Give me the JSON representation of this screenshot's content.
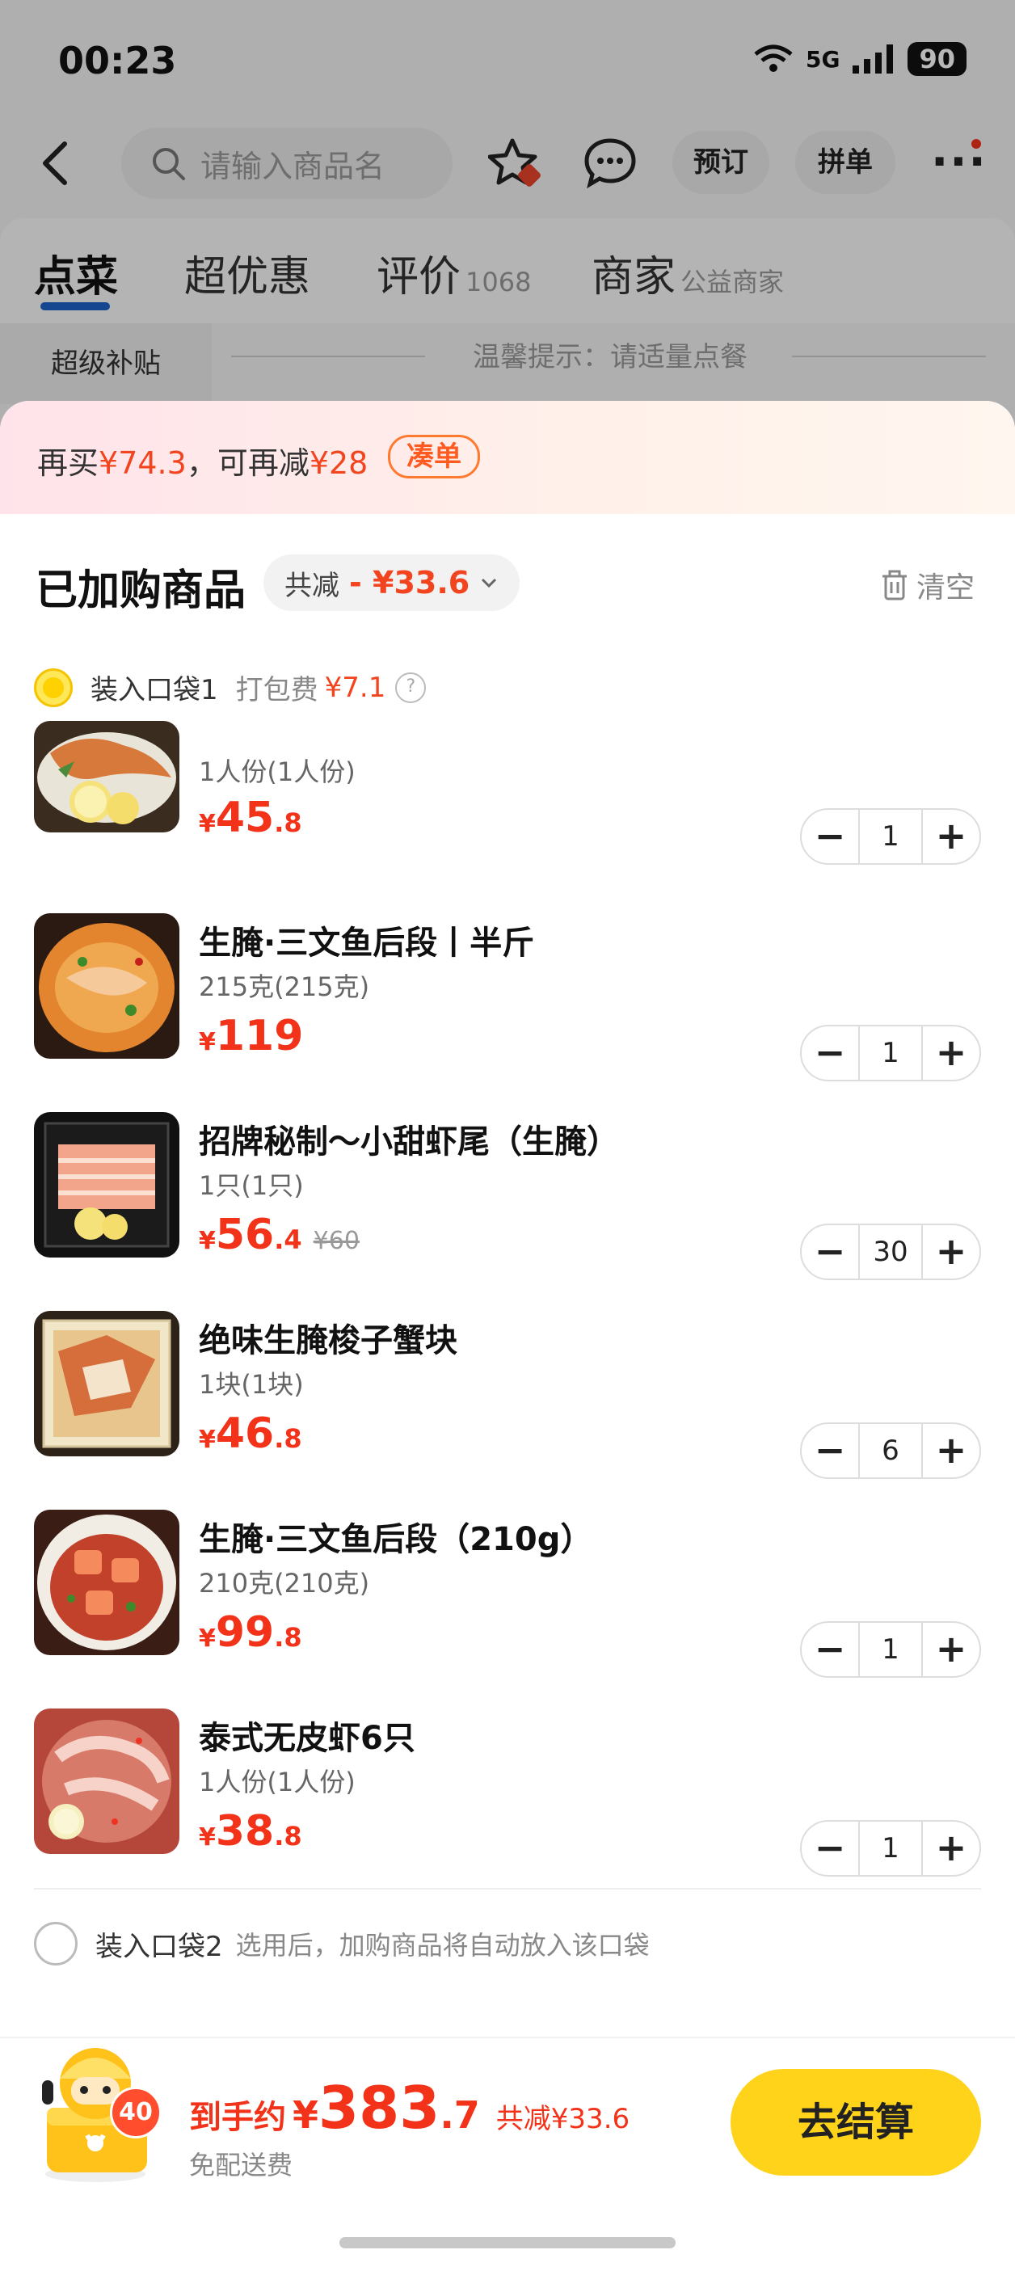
{
  "status_bar": {
    "time": "00:23",
    "network": "5G",
    "battery": "90"
  },
  "header": {
    "search_placeholder": "请输入商品名",
    "preorder_label": "预订",
    "group_order_label": "拼单"
  },
  "tabs": [
    {
      "label": "点菜",
      "sub": ""
    },
    {
      "label": "超优惠",
      "sub": ""
    },
    {
      "label": "评价",
      "sub": "1068"
    },
    {
      "label": "商家",
      "sub": "公益商家"
    }
  ],
  "sidebar_first": "超级补贴",
  "notice": "温馨提示：请适量点餐",
  "promo": {
    "prefix": "再买",
    "amount1": "¥74.3",
    "middle": "，可再减",
    "amount2": "¥28",
    "button": "凑单"
  },
  "cart": {
    "title": "已加购商品",
    "discount_label": "共减",
    "discount_amount": "- ¥33.6",
    "clear_label": "清空"
  },
  "bag1": {
    "label": "装入口袋1",
    "packing_label": "打包费",
    "packing_fee": "¥7.1"
  },
  "items": [
    {
      "name": "",
      "spec": "1人份(1人份)",
      "price_int": "45",
      "price_dec": ".8",
      "old_price": "",
      "qty": "1"
    },
    {
      "name": "生腌·三文鱼后段丨半斤",
      "spec": "215克(215克)",
      "price_int": "119",
      "price_dec": "",
      "old_price": "",
      "qty": "1"
    },
    {
      "name": "招牌秘制～小甜虾尾（生腌）",
      "spec": "1只(1只)",
      "price_int": "56",
      "price_dec": ".4",
      "old_price": "¥60",
      "qty": "30"
    },
    {
      "name": "绝味生腌梭子蟹块",
      "spec": "1块(1块)",
      "price_int": "46",
      "price_dec": ".8",
      "old_price": "",
      "qty": "6"
    },
    {
      "name": "生腌·三文鱼后段（210g）",
      "spec": "210克(210克)",
      "price_int": "99",
      "price_dec": ".8",
      "old_price": "",
      "qty": "1"
    },
    {
      "name": "泰式无皮虾6只",
      "spec": "1人份(1人份)",
      "price_int": "38",
      "price_dec": ".8",
      "old_price": "",
      "qty": "1"
    }
  ],
  "currency": "¥",
  "bag2": {
    "label": "装入口袋2",
    "hint": "选用后，加购商品将自动放入该口袋"
  },
  "footer": {
    "cart_count": "40",
    "total_label": "到手约",
    "total_int": "383",
    "total_dec": ".7",
    "saved": "共减¥33.6",
    "delivery": "免配送费",
    "checkout_label": "去结算"
  }
}
